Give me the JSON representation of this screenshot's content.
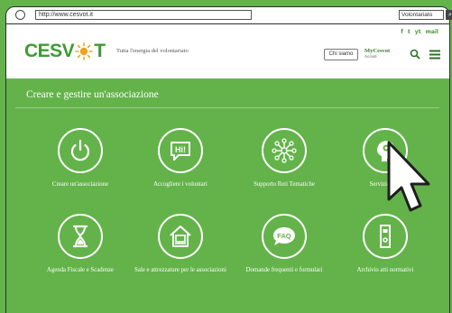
{
  "browser": {
    "url": "http://www.cesvot.it",
    "search_value": "Volontariato"
  },
  "header": {
    "logo_text_left": "CESV",
    "logo_text_right": "T",
    "tagline": "Tutta l'energia del volontariato",
    "chi_siamo_label": "Chi siamo",
    "mycesvot_label": "MyCesvot",
    "mycesvot_sub": "Accedi",
    "social": [
      "f",
      "t",
      "yt",
      "mail"
    ]
  },
  "main": {
    "section_title": "Creare e gestire un'associazione",
    "items": [
      {
        "label": "Creare un'associazione",
        "icon": "power-icon"
      },
      {
        "label": "Accogliere i volontari",
        "icon": "speech-bubble-hi-icon"
      },
      {
        "label": "Supporto Reti Tematiche",
        "icon": "network-icon"
      },
      {
        "label": "Servizio di o",
        "icon": "head-gear-icon"
      },
      {
        "label": "Agenda Fiscale e Scadenze",
        "icon": "hourglass-icon"
      },
      {
        "label": "Sale e attrezzature per le associazioni",
        "icon": "house-computer-icon"
      },
      {
        "label": "Domande frequenti e formulari",
        "icon": "faq-bubble-icon"
      },
      {
        "label": "Archivio atti normativi",
        "icon": "binder-icon"
      }
    ]
  },
  "colors": {
    "brand_green": "#3e9a35",
    "page_green": "#63b34a",
    "accent_orange": "#f0a21c"
  }
}
